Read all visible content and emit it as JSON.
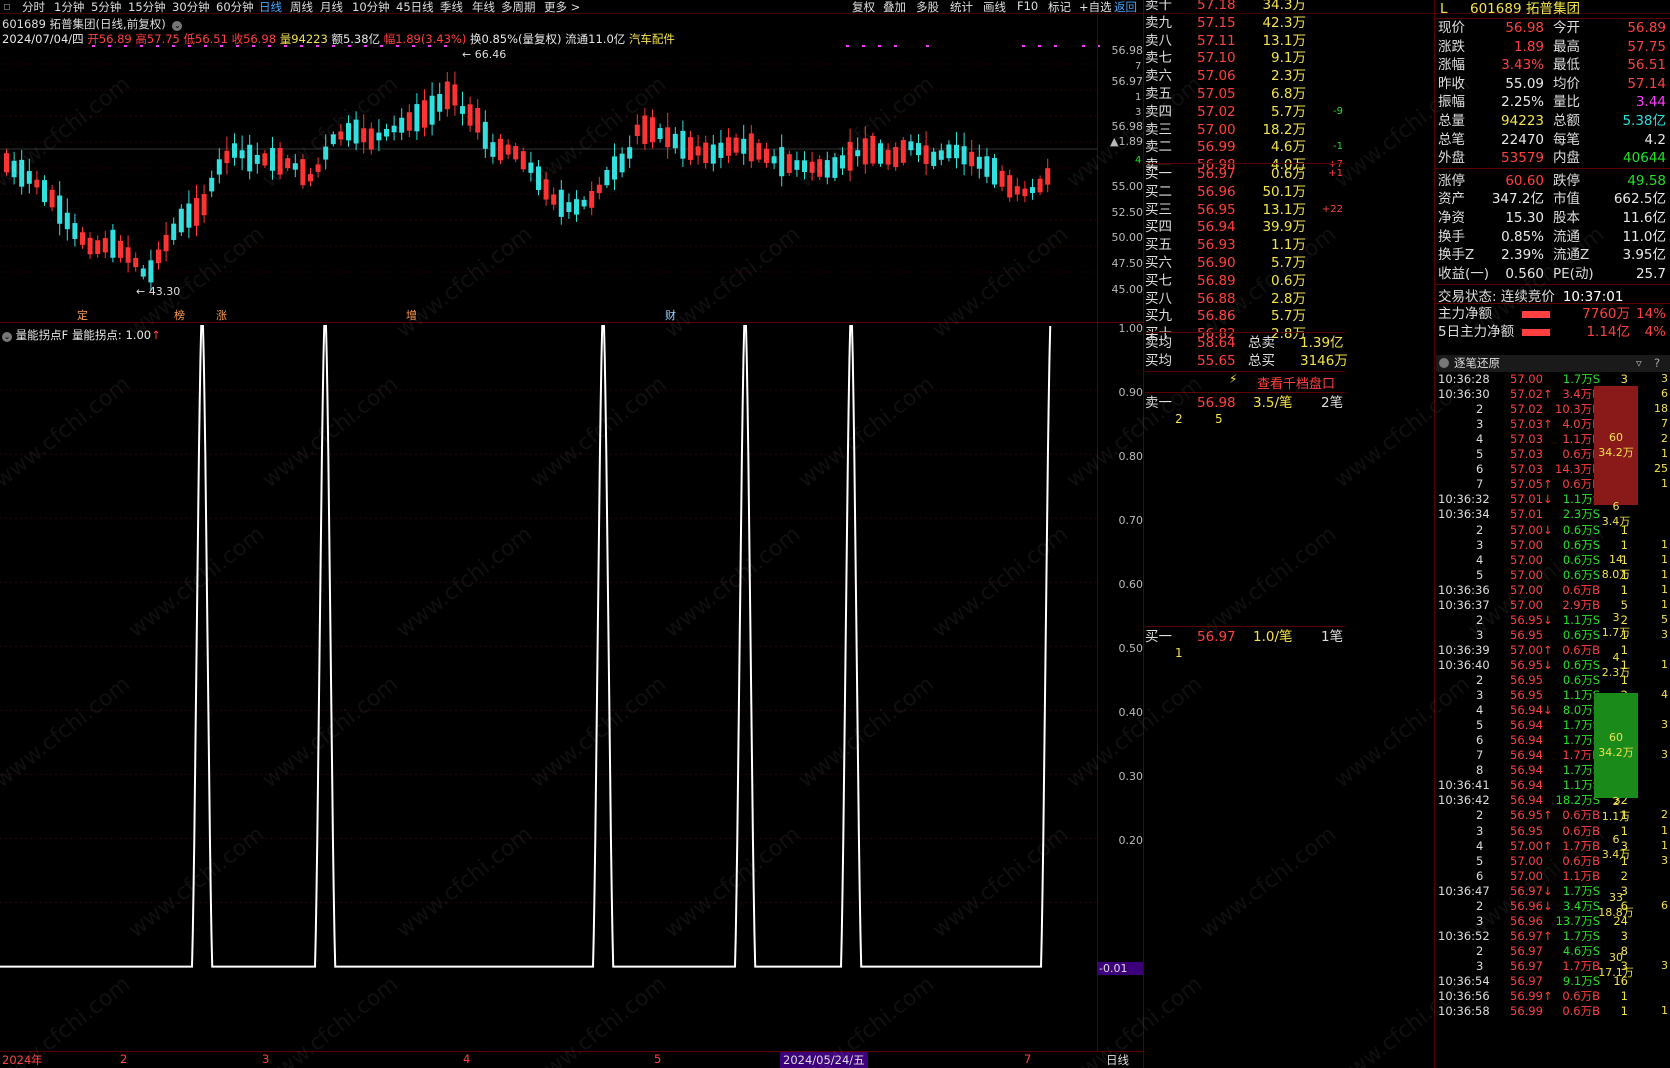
{
  "toolbar": {
    "periods": [
      "分时",
      "1分钟",
      "5分钟",
      "15分钟",
      "30分钟",
      "60分钟",
      "日线",
      "周线",
      "月线",
      "10分钟",
      "45日线",
      "季线",
      "年线",
      "多周期",
      "更多 >"
    ],
    "right": [
      "复权",
      "叠加",
      "多股",
      "统计",
      "画线",
      "F10",
      "标记",
      "+自选",
      "返回"
    ]
  },
  "kline": {
    "title": "601689 拓普集团(日线,前复权)",
    "date": "2024/07/04/四",
    "open_label": "开",
    "open": "56.89",
    "high_label": "高",
    "high": "57.75",
    "low_label": "低",
    "low": "56.51",
    "close_label": "收",
    "close": "56.98",
    "vol_label": "量",
    "vol": "94223",
    "amt": "额5.38亿",
    "chg_label": "幅",
    "chg": "1.89(3.43%)",
    "turnover": "换0.85%(量复权)",
    "float": "流通11.0亿",
    "sector": "汽车配件",
    "max_label": "66.46",
    "min_label": "43.30",
    "event_tags": [
      "定",
      "榜",
      "涨",
      "增",
      "财"
    ],
    "axis": [
      "56.98",
      "56.97",
      "56.98",
      "▲1.89",
      "55.00",
      "52.50",
      "50.00",
      "47.50",
      "45.00"
    ],
    "axis_small": [
      "7",
      "1",
      "3",
      "4"
    ]
  },
  "indicator": {
    "title": "量能拐点F",
    "value_label": "量能拐点: 1.00",
    "axis": [
      "1.00",
      "0.90",
      "0.80",
      "0.70",
      "0.60",
      "0.50",
      "0.40",
      "0.30",
      "0.20",
      "-0.01"
    ]
  },
  "xaxis": {
    "labels": [
      "2024年",
      "2",
      "3",
      "4",
      "5",
      "2024/05/24/五",
      "7"
    ],
    "period": "日线"
  },
  "orderbook": {
    "asks": [
      {
        "label": "卖十",
        "price": "57.18",
        "vol": "34.3万",
        "chg": ""
      },
      {
        "label": "卖九",
        "price": "57.15",
        "vol": "42.3万",
        "chg": ""
      },
      {
        "label": "卖八",
        "price": "57.11",
        "vol": "13.1万",
        "chg": ""
      },
      {
        "label": "卖七",
        "price": "57.10",
        "vol": "9.1万",
        "chg": ""
      },
      {
        "label": "卖六",
        "price": "57.06",
        "vol": "2.3万",
        "chg": ""
      },
      {
        "label": "卖五",
        "price": "57.05",
        "vol": "6.8万",
        "chg": ""
      },
      {
        "label": "卖四",
        "price": "57.02",
        "vol": "5.7万",
        "chg": "-9"
      },
      {
        "label": "卖三",
        "price": "57.00",
        "vol": "18.2万",
        "chg": ""
      },
      {
        "label": "卖二",
        "price": "56.99",
        "vol": "4.6万",
        "chg": "-1"
      },
      {
        "label": "卖一",
        "price": "56.98",
        "vol": "4.0万",
        "chg": "+7"
      }
    ],
    "bids": [
      {
        "label": "买一",
        "price": "56.97",
        "vol": "0.6万",
        "chg": "+1"
      },
      {
        "label": "买二",
        "price": "56.96",
        "vol": "50.1万",
        "chg": ""
      },
      {
        "label": "买三",
        "price": "56.95",
        "vol": "13.1万",
        "chg": "+22"
      },
      {
        "label": "买四",
        "price": "56.94",
        "vol": "39.9万",
        "chg": ""
      },
      {
        "label": "买五",
        "price": "56.93",
        "vol": "1.1万",
        "chg": ""
      },
      {
        "label": "买六",
        "price": "56.90",
        "vol": "5.7万",
        "chg": ""
      },
      {
        "label": "买七",
        "price": "56.89",
        "vol": "0.6万",
        "chg": ""
      },
      {
        "label": "买八",
        "price": "56.88",
        "vol": "2.8万",
        "chg": ""
      },
      {
        "label": "买九",
        "price": "56.86",
        "vol": "5.7万",
        "chg": ""
      },
      {
        "label": "买十",
        "price": "56.82",
        "vol": "2.8万",
        "chg": ""
      }
    ],
    "avg_sell_label": "卖均",
    "avg_sell": "58.64",
    "total_sell_label": "总卖",
    "total_sell": "1.39亿",
    "avg_buy_label": "买均",
    "avg_buy": "55.65",
    "total_buy_label": "总买",
    "total_buy": "3146万",
    "thousand_btn": "查看千档盘口",
    "sell1_detail": {
      "label": "卖一",
      "price": "56.98",
      "per": "3.5/笔",
      "count": "2笔",
      "orders": [
        "2",
        "5"
      ]
    },
    "buy1_detail": {
      "label": "买一",
      "price": "56.97",
      "per": "1.0/笔",
      "count": "1笔",
      "orders": [
        "1"
      ]
    }
  },
  "quote": {
    "flag": "L",
    "code": "601689",
    "name": "拓普集团",
    "rows": [
      [
        "现价",
        "56.98",
        "今开",
        "56.89"
      ],
      [
        "涨跌",
        "1.89",
        "最高",
        "57.75"
      ],
      [
        "涨幅",
        "3.43%",
        "最低",
        "56.51"
      ],
      [
        "昨收",
        "55.09",
        "均价",
        "57.14"
      ],
      [
        "振幅",
        "2.25%",
        "量比",
        "3.44"
      ],
      [
        "总量",
        "94223",
        "总额",
        "5.38亿"
      ],
      [
        "总笔",
        "22470",
        "每笔",
        "4.2"
      ],
      [
        "外盘",
        "53579",
        "内盘",
        "40644"
      ],
      [
        "涨停",
        "60.60",
        "跌停",
        "49.58"
      ],
      [
        "资产",
        "347.2亿",
        "市值",
        "662.5亿"
      ],
      [
        "净资",
        "15.30",
        "股本",
        "11.6亿"
      ],
      [
        "换手",
        "0.85%",
        "流通",
        "11.0亿"
      ],
      [
        "换手Z",
        "2.39%",
        "流通Z",
        "3.95亿"
      ],
      [
        "收益(一)",
        "0.560",
        "PE(动)",
        "25.7"
      ]
    ],
    "trade_state": "交易状态: 连续竞价",
    "time": "10:37:01",
    "main_flow_label": "主力净额",
    "main_flow": "7760万",
    "main_flow_pct": "14%",
    "main5_label": "5日主力净额",
    "main5": "1.14亿",
    "main5_pct": "4%"
  },
  "ticks": {
    "title": "逐笔还原",
    "rows": [
      [
        "10:36:28",
        "57.00",
        "1.7万S",
        "3",
        ""
      ],
      [
        "10:36:30",
        "57.02↑",
        "3.4万B",
        "",
        ""
      ],
      [
        "2",
        "57.02",
        "10.3万B",
        "18",
        ""
      ],
      [
        "3",
        "57.03↑",
        "4.0万B",
        "7",
        ""
      ],
      [
        "4",
        "57.03",
        "1.1万B",
        "2",
        ""
      ],
      [
        "5",
        "57.03",
        "0.6万B",
        "1",
        ""
      ],
      [
        "6",
        "57.03",
        "14.3万B",
        "25",
        ""
      ],
      [
        "7",
        "57.05↑",
        "0.6万B",
        "1",
        ""
      ],
      [
        "10:36:32",
        "57.01↓",
        "1.1万S",
        "2",
        ""
      ],
      [
        "10:36:34",
        "57.01",
        "2.3万S",
        "",
        ""
      ],
      [
        "2",
        "57.00↓",
        "0.6万S",
        "1",
        ""
      ],
      [
        "3",
        "57.00",
        "0.6万S",
        "1",
        ""
      ],
      [
        "4",
        "57.00",
        "0.6万S",
        "1",
        ""
      ],
      [
        "5",
        "57.00",
        "0.6万S",
        "1",
        ""
      ],
      [
        "10:36:36",
        "57.00",
        "0.6万B",
        "1",
        ""
      ],
      [
        "10:36:37",
        "57.00",
        "2.9万B",
        "5",
        ""
      ],
      [
        "2",
        "56.95↓",
        "1.1万S",
        "2",
        ""
      ],
      [
        "3",
        "56.95",
        "0.6万S",
        "1",
        ""
      ],
      [
        "10:36:39",
        "57.00↑",
        "0.6万B",
        "1",
        ""
      ],
      [
        "10:36:40",
        "56.95↓",
        "0.6万S",
        "1",
        ""
      ],
      [
        "2",
        "56.95",
        "0.6万S",
        "1",
        ""
      ],
      [
        "3",
        "56.95",
        "1.1万S",
        "2",
        ""
      ],
      [
        "4",
        "56.94↓",
        "8.0万S",
        "14",
        ""
      ],
      [
        "5",
        "56.94",
        "1.7万S",
        "3",
        ""
      ],
      [
        "6",
        "56.94",
        "1.7万S",
        "3",
        ""
      ],
      [
        "7",
        "56.94",
        "1.7万B",
        "3",
        ""
      ],
      [
        "8",
        "56.94",
        "1.7万S",
        "3",
        ""
      ],
      [
        "10:36:41",
        "56.94",
        "1.1万S",
        "2",
        ""
      ],
      [
        "10:36:42",
        "56.94",
        "18.2万S",
        "32",
        ""
      ],
      [
        "2",
        "56.95↑",
        "0.6万B",
        "1",
        ""
      ],
      [
        "3",
        "56.95",
        "0.6万B",
        "1",
        ""
      ],
      [
        "4",
        "57.00↑",
        "1.7万B",
        "3",
        ""
      ],
      [
        "5",
        "57.00",
        "0.6万B",
        "1",
        ""
      ],
      [
        "6",
        "57.00",
        "1.1万B",
        "2",
        ""
      ],
      [
        "10:36:47",
        "56.97↓",
        "1.7万S",
        "3",
        ""
      ],
      [
        "2",
        "56.96↓",
        "3.4万S",
        "6",
        ""
      ],
      [
        "3",
        "56.96",
        "13.7万S",
        "24",
        ""
      ],
      [
        "10:36:52",
        "56.97↑",
        "1.7万S",
        "3",
        ""
      ],
      [
        "2",
        "56.97",
        "4.6万S",
        "8",
        ""
      ],
      [
        "3",
        "56.97",
        "1.7万B",
        "3",
        ""
      ],
      [
        "10:36:54",
        "56.97",
        "9.1万S",
        "16",
        ""
      ],
      [
        "10:36:56",
        "56.99↑",
        "0.6万B",
        "1",
        ""
      ],
      [
        "10:36:58",
        "56.99",
        "0.6万B",
        "1",
        ""
      ]
    ],
    "groups": [
      {
        "count": "60",
        "amount": "34.2万",
        "side": "B"
      },
      {
        "count": "6",
        "amount": "3.4万",
        "side": "S"
      },
      {
        "count": "14",
        "amount": "8.0万",
        "side": "S"
      },
      {
        "count": "3",
        "amount": "1.7万",
        "side": "S"
      },
      {
        "count": "4",
        "amount": "2.3万",
        "side": "S"
      },
      {
        "count": "60",
        "amount": "34.2万",
        "side": "S"
      },
      {
        "count": "2",
        "amount": "1.1万",
        "side": "B"
      },
      {
        "count": "6",
        "amount": "3.4万",
        "side": "B"
      },
      {
        "count": "33",
        "amount": "18.8万",
        "side": "S"
      },
      {
        "count": "30",
        "amount": "17.1万",
        "side": "S"
      },
      {
        "count": "",
        "amount": "",
        "side": ""
      }
    ]
  },
  "watermark": "www.cfchi.com",
  "colors": {
    "up": "#ff3333",
    "down": "#33e0e0",
    "grid": "#5a0000",
    "line": "#ffffff"
  }
}
